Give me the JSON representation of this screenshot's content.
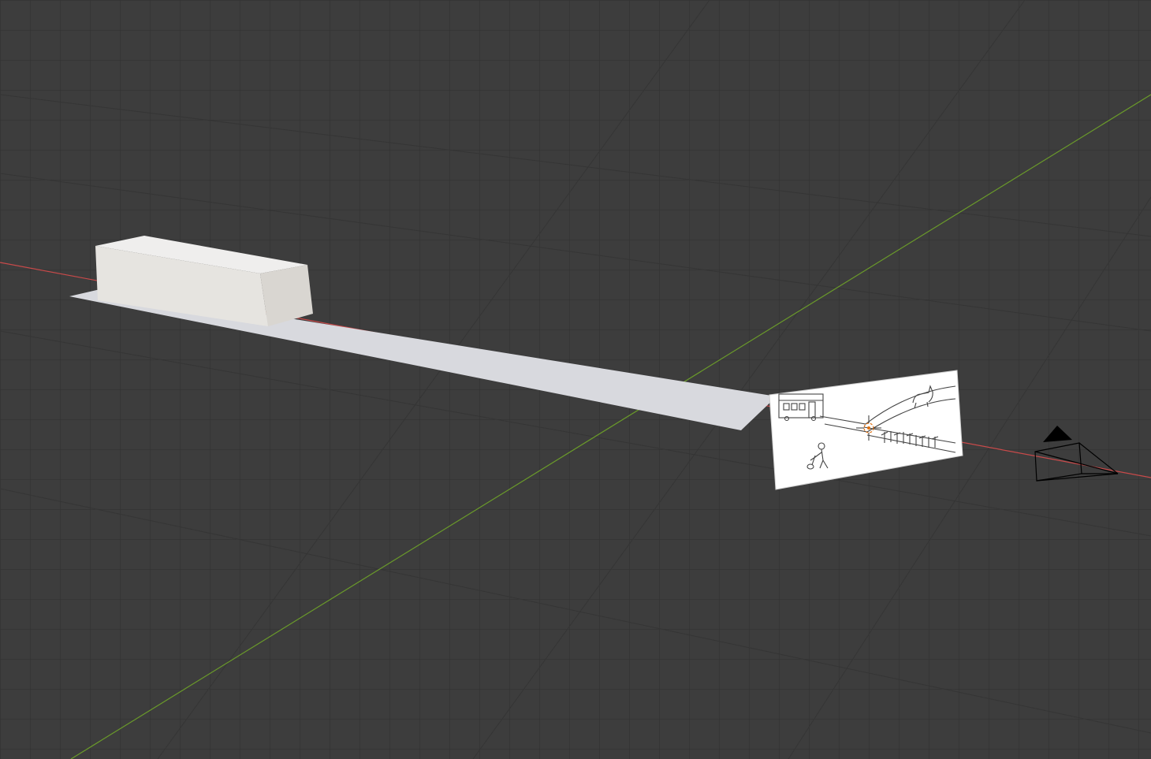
{
  "viewport": {
    "name": "3d-viewport",
    "background_color": "#3d3d3d",
    "grid_color": "#2e2e2e",
    "x_axis_color": "#c94a4a",
    "y_axis_color": "#6a9a2a"
  },
  "scene_objects": [
    {
      "name": "box",
      "kind": "mesh-cube",
      "color": "#e6e4e0"
    },
    {
      "name": "ground-plane",
      "kind": "mesh-plane",
      "color": "#d8d9de"
    },
    {
      "name": "reference-image",
      "kind": "image-empty",
      "content": "trolley-problem-sketch",
      "color": "#ffffff"
    },
    {
      "name": "camera",
      "kind": "camera",
      "color": "#000000"
    },
    {
      "name": "origin",
      "kind": "object-origin",
      "color": "#e07010"
    }
  ]
}
